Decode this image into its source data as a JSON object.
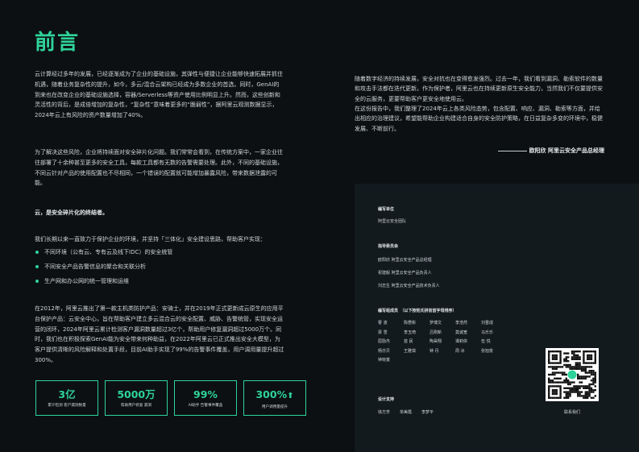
{
  "heading": "前言",
  "left": {
    "p1": "云计算经过多年的发展，已经逐渐成为了企业的基础设施，其弹性与便捷让企业能够快速拓展并抓住机遇，随着业务复杂性的提升，如今，多云/混合云架构已经成为多数企业的首选。同时，GenAI的到来也在改变企业的基础设施选择，容器/Serverless等资产使用比例明显上升。然而，这些创新和灵活性的背后，是成倍增加的复杂性，“复杂性”意味着更多的“脆弱性”，据阿里云观测数据显示，2024年云上有风险的资产数量增加了40%。",
    "p2": "为了解决这些风险，企业将持续面对安全碎片化问题。我们常常会看到，在传统方案中，一家企业往往部署了十余种甚至更多的安全工具，每款工具都有无数的告警需要处理。此外，不同的基础设施，不同云针对产品的使用配置也不尽相同，一个错误的配置就可能增加暴露风险，带来数据泄露的可能。",
    "p3": "云，是安全碎片化的终结者。",
    "p4": "我们长期以来一直致力于保护企业的环境，并坚持「三体化」安全建设思路，帮助客户实现：",
    "bullets": [
      "不同环境（公有云、专有云及线下IDC）的安全统管",
      "不同安全产品告警信息的聚合和关联分析",
      "生产网和办公网的统一管理和运维"
    ],
    "p5": "在2012年，阿里云推出了第一款主机类防护产品：安骑士，并在2019年正式更新成云原生的应用平台保护产品：云安全中心，旨在帮助客户建立多云混合云的安全配置、威胁、告警统管，实现安全运营的闭环，2024年阿里云累计检测客户漏洞数量超过3亿个，帮助用户修复漏洞超过5000万个。同时，我们也在积极探索GenAI能为安全带来何种助益，在2022年阿里云已正式推出安全大模型，为客户提供清晰的风险解释和处置手段，目前AI助手实现了99%的告警事件覆盖，用户调用量提升超过300%。",
    "stats": [
      {
        "value": "3亿",
        "label": "累计检测 客户漏洞数量"
      },
      {
        "value": "5000万",
        "label": "帮助用户修复 漏洞"
      },
      {
        "value": "99%",
        "label": "AI助手 告警事件覆盖"
      },
      {
        "value": "300%",
        "label": "用户调用量提升"
      }
    ]
  },
  "right": {
    "r1": "随着数字经济的持续发展，安全对抗也在变得愈发强烈。过去一年，我们看到漏洞、勒索软件的数量和攻击手法都在迭代更新。作为保护者，阿里云也在持续更新原生安全能力，当然我们不仅要提供安全的云服务，更要帮助客户更安全地使用云。",
    "r2": "在这份报告中，我们整理了2024年云上各类风险态势，包含配置、响应、漏洞、勒索等方面，并给出相应的治理建议，希望能帮助企业构建适合自身的安全防护策略，在日益复杂多变的环境中，稳健发展、不断前行。",
    "signature": "欧阳欣 阿里云安全产品总经理"
  },
  "credits": {
    "unit_title": "编写单位",
    "unit": "阿里云安全团队",
    "committee_title": "指导委员会",
    "committee": [
      "欧阳欣 阿里云安全产品总经理",
      "祝建毅 阿里云安全产品负责人",
      "刘志生 阿里云安全产品技术负责人"
    ],
    "members_title": "编写组成员　（以下按姓氏拼音首字母排序）",
    "members": [
      "曹 波",
      "陈懋彬",
      "罗博文",
      "李浩然",
      "刘晋成",
      "梁 雪",
      "李玉琦",
      "吕刚新",
      "莫诚宽",
      "马乐乐",
      "屈励杰",
      "苗 民",
      "陶昊翔",
      "谭莉依",
      "伍 悦",
      "杨亦贝",
      "王雅琪",
      "钟 丹",
      "周 冰",
      "张旭俊",
      "钟晓童"
    ],
    "support_title": "设计支持",
    "support": [
      "徐方芳",
      "单美霞",
      "李梦平"
    ],
    "contact": "联系我们"
  },
  "colors": {
    "accent": "#2fd39a",
    "background": "#0c1012",
    "panel": "#121a1e"
  },
  "icons": {
    "stat_arrow": "arrow-up-icon",
    "qr": "qr-code"
  }
}
